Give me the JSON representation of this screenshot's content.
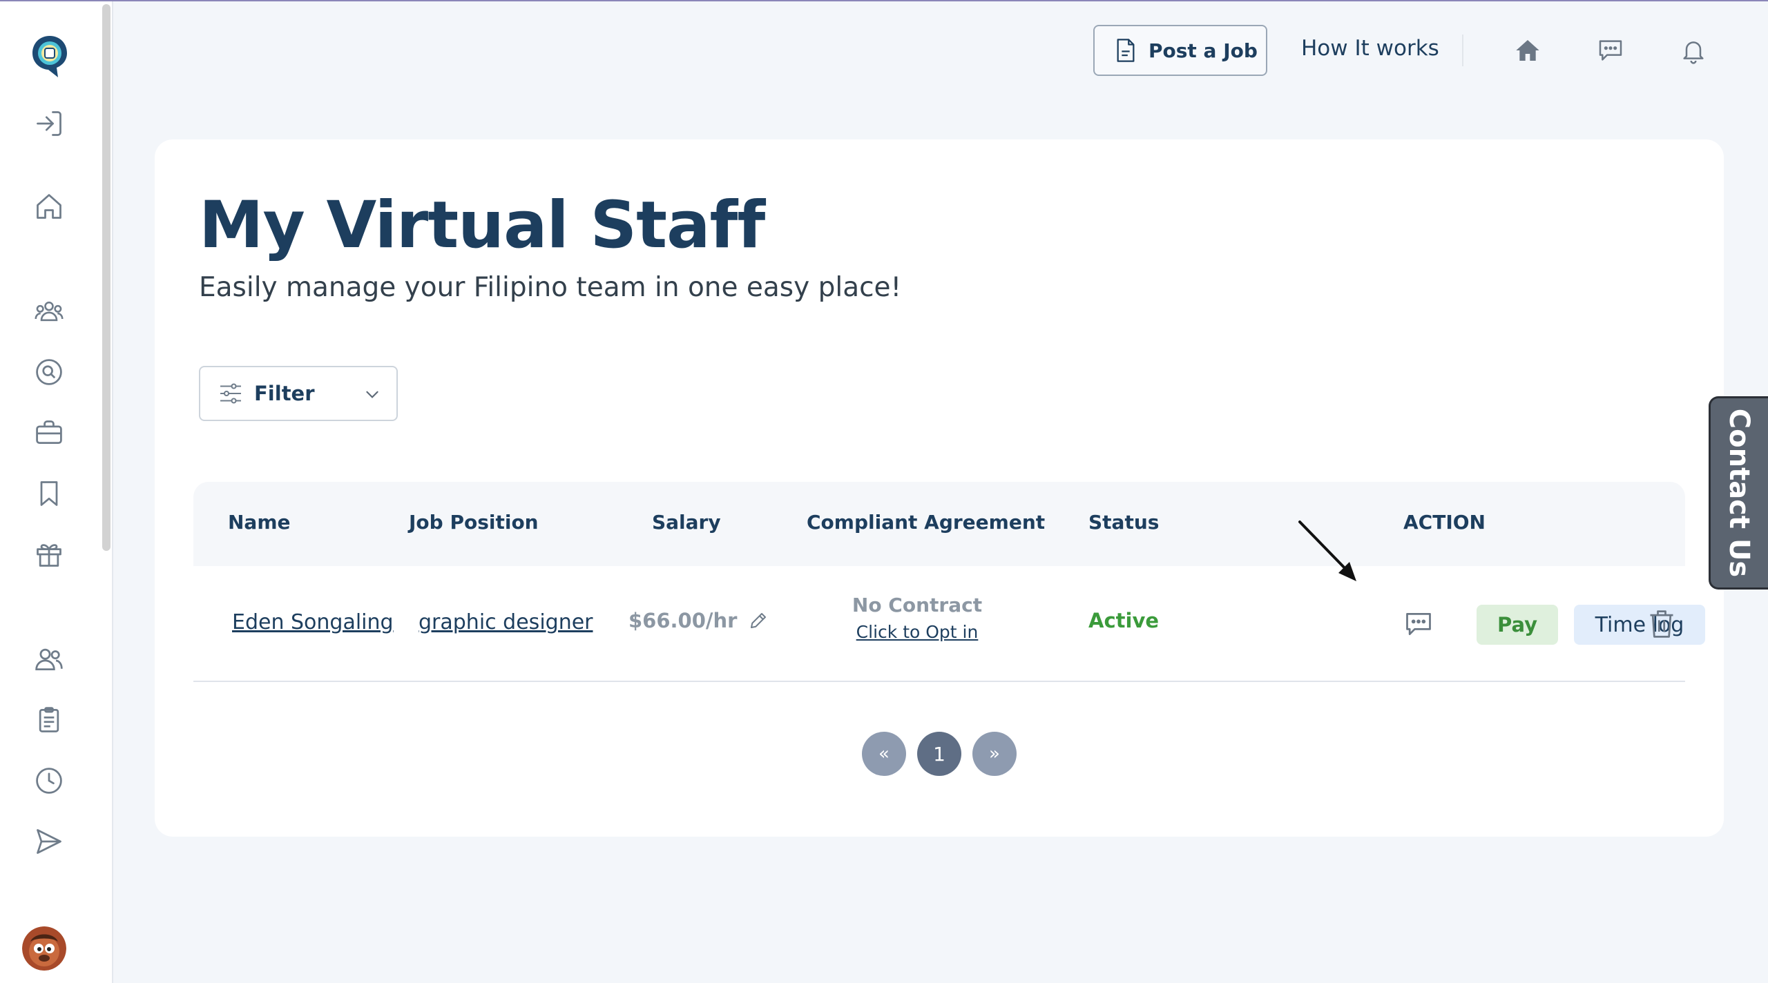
{
  "header": {
    "post_job_label": "Post a Job",
    "how_it_works_label": "How It works"
  },
  "page": {
    "title": "My Virtual Staff",
    "subtitle": "Easily manage your Filipino team in one easy place!"
  },
  "filter": {
    "label": "Filter"
  },
  "table": {
    "columns": [
      "Name",
      "Job Position",
      "Salary",
      "Compliant Agreement",
      "Status",
      "ACTION"
    ],
    "rows": [
      {
        "name": "Eden Songaling",
        "job_position": "graphic designer",
        "salary": "$66.00/hr",
        "agreement_status": "No Contract",
        "agreement_link": "Click to Opt in",
        "status": "Active",
        "pay_label": "Pay",
        "timelog_label": "Time log"
      }
    ]
  },
  "pagination": {
    "prev": "«",
    "current": "1",
    "next": "»"
  },
  "contact_tab": {
    "label": "Contact Us"
  },
  "icons": {
    "sidebar": [
      "logo-icon",
      "login-icon",
      "home-icon",
      "team-icon",
      "search-icon",
      "briefcase-icon",
      "bookmark-icon",
      "gift-icon",
      "users-icon",
      "clipboard-icon",
      "clock-icon",
      "send-icon"
    ],
    "header": [
      "document-icon",
      "home-filled-icon",
      "chat-icon",
      "bell-icon"
    ]
  },
  "colors": {
    "primary": "#1d3e5e",
    "status_active": "#3b9b3b",
    "pay_bg": "#dff0dd",
    "timelog_bg": "#e2edfb",
    "background": "#f3f6fa"
  }
}
